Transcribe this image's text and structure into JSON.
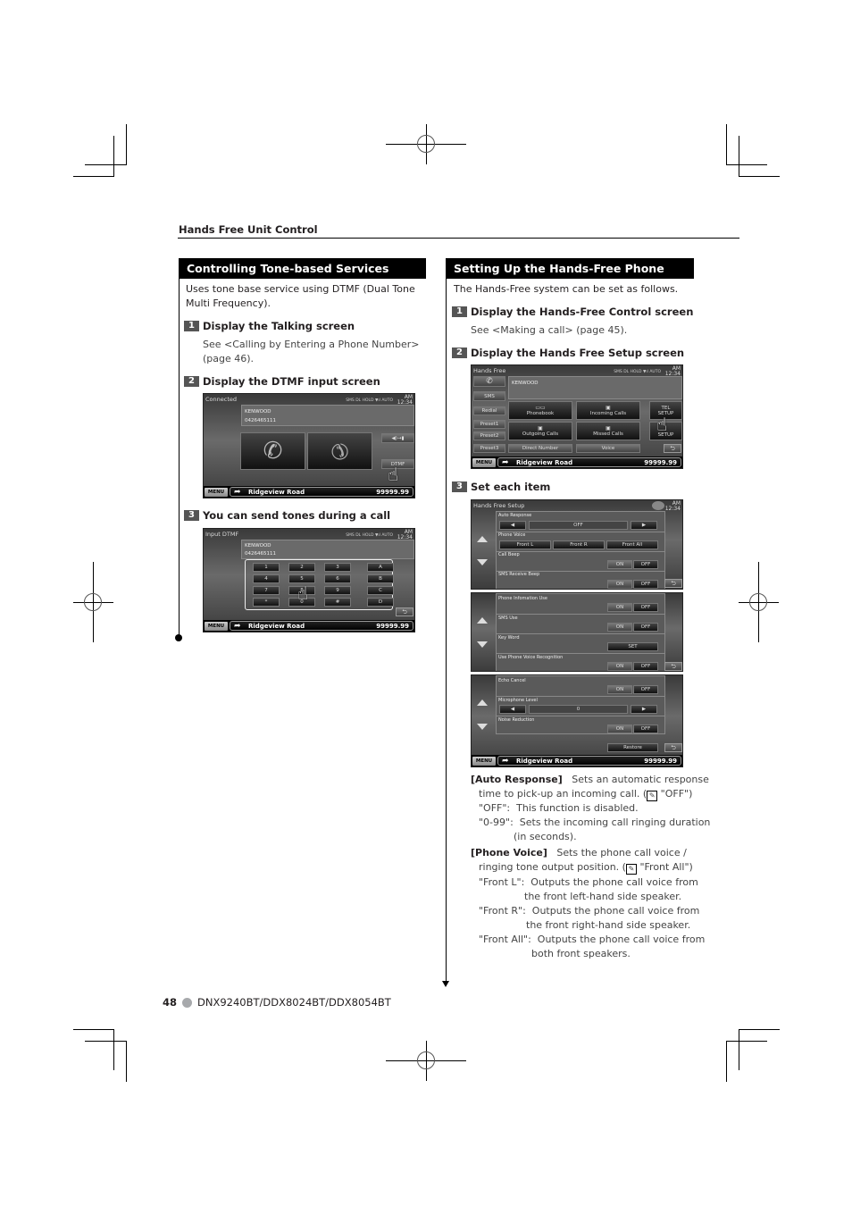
{
  "header": {
    "section": "Hands Free Unit Control"
  },
  "left": {
    "title": "Controlling Tone-based Services",
    "intro": "Uses tone base service using DTMF (Dual Tone Multi Frequency).",
    "intro_line1": "Uses tone base service using DTMF (Dual Tone",
    "intro_line2": "Multi Frequency).",
    "steps": [
      {
        "num": "1",
        "label": "Display the Talking screen",
        "note_line1": "See <Calling by Entering a Phone Number>",
        "note_line2": "(page 46)."
      },
      {
        "num": "2",
        "label": "Display the DTMF input screen"
      },
      {
        "num": "3",
        "label": "You can send tones during a call"
      }
    ],
    "talking_screen": {
      "title": "Connected",
      "status": "SMS DL HOLD ▼ıl  AUTO",
      "clock_ampm": "AM",
      "clock_time": "12:34",
      "contact_name": "KENWOOD",
      "contact_number": "0426465111",
      "audio_switch_label": "◀)→▮",
      "dtmf_label": "DTMF",
      "menu_label": "MENU",
      "road": "Ridgeview Road",
      "distance": "99999.99"
    },
    "dtmf_screen": {
      "title": "Input DTMF",
      "status": "SMS DL HOLD ▼ıl  AUTO",
      "clock_ampm": "AM",
      "clock_time": "12:34",
      "contact_name": "KENWOOD",
      "contact_number": "0426465111",
      "keys": [
        [
          "1",
          "2",
          "3",
          "A"
        ],
        [
          "4",
          "5",
          "6",
          "B"
        ],
        [
          "7",
          "8",
          "9",
          "C"
        ],
        [
          "*",
          "0",
          "#",
          "D"
        ]
      ],
      "menu_label": "MENU",
      "road": "Ridgeview Road",
      "distance": "99999.99"
    }
  },
  "right": {
    "title": "Setting Up the Hands-Free Phone",
    "intro": "The Hands-Free system can be set as follows.",
    "steps": [
      {
        "num": "1",
        "label": "Display the Hands-Free Control screen",
        "note": "See <Making a call> (page 45)."
      },
      {
        "num": "2",
        "label": "Display the Hands Free Setup screen"
      },
      {
        "num": "3",
        "label": "Set each item"
      }
    ],
    "hf_screen": {
      "title": "Hands Free",
      "status": "SMS DL HOLD ▼ıl  AUTO",
      "clock_ampm": "AM",
      "clock_time": "12:34",
      "contact_name": "KENWOOD",
      "side_buttons": [
        "",
        "SMS",
        "Redial",
        "Preset1",
        "Preset2",
        "Preset3"
      ],
      "grid_buttons": [
        {
          "label": "Phonebook",
          "icon": "📖"
        },
        {
          "label": "Incoming Calls",
          "icon": "⇲"
        },
        {
          "label": "Outgoing Calls",
          "icon": "⇱"
        },
        {
          "label": "Missed Calls",
          "icon": "⇲"
        }
      ],
      "direct_number": "Direct Number",
      "voice": "Voice",
      "tel_setup_line1": "TEL",
      "tel_setup_line2": "SETUP",
      "sound_label": "SETUP",
      "menu_label": "MENU",
      "road": "Ridgeview Road",
      "distance": "99999.99"
    },
    "setup_screen": {
      "title": "Hands Free Setup",
      "clock_ampm": "AM",
      "clock_time": "12:34",
      "page1": {
        "auto_response_label": "Auto Response",
        "auto_response_value": "OFF",
        "phone_voice_label": "Phone Voice",
        "phone_voice_options": [
          "Front L",
          "Front R",
          "Front All"
        ],
        "call_beep_label": "Call Beep",
        "sms_beep_label": "SMS Receive Beep",
        "on": "ON",
        "off": "OFF"
      },
      "page2": {
        "phone_info_label": "Phone Infomation Use",
        "sms_use_label": "SMS Use",
        "key_word_label": "Key Word",
        "key_word_button": "SET",
        "voice_recog_label": "Use Phone Voice Recognition",
        "on": "ON",
        "off": "OFF"
      },
      "page3": {
        "echo_cancel_label": "Echo Cancel",
        "mic_level_label": "Microphone Level",
        "mic_level_value": "0",
        "noise_reduction_label": "Noise Reduction",
        "restore_label": "Restore",
        "on": "ON",
        "off": "OFF"
      },
      "menu_label": "MENU",
      "road": "Ridgeview Road",
      "distance": "99999.99"
    },
    "descriptions": {
      "auto_response": {
        "term": "[Auto Response]",
        "text": "Sets an automatic response",
        "line2_pre": "time to pick-up an incoming call. (",
        "line2_post": " \"OFF\")",
        "opts": [
          {
            "key": "\"OFF\":",
            "text": "This function is disabled."
          },
          {
            "key": "\"0-99\":",
            "text": "Sets the incoming call ringing duration",
            "cont": "(in seconds)."
          }
        ]
      },
      "phone_voice": {
        "term": "[Phone Voice]",
        "text": "Sets the phone call voice /",
        "line2_pre": "ringing tone output position. (",
        "line2_post": " \"Front All\")",
        "opts": [
          {
            "key": "\"Front L\":",
            "text": "Outputs the phone call voice from",
            "cont": "the front left-hand side speaker."
          },
          {
            "key": "\"Front R\":",
            "text": "Outputs the phone call voice from",
            "cont": "the front right-hand side speaker."
          },
          {
            "key": "\"Front All\":",
            "text": "Outputs the phone call voice from",
            "cont": "both front speakers."
          }
        ]
      }
    }
  },
  "footer": {
    "page_number": "48",
    "models": "DNX9240BT/DDX8024BT/DDX8054BT"
  }
}
